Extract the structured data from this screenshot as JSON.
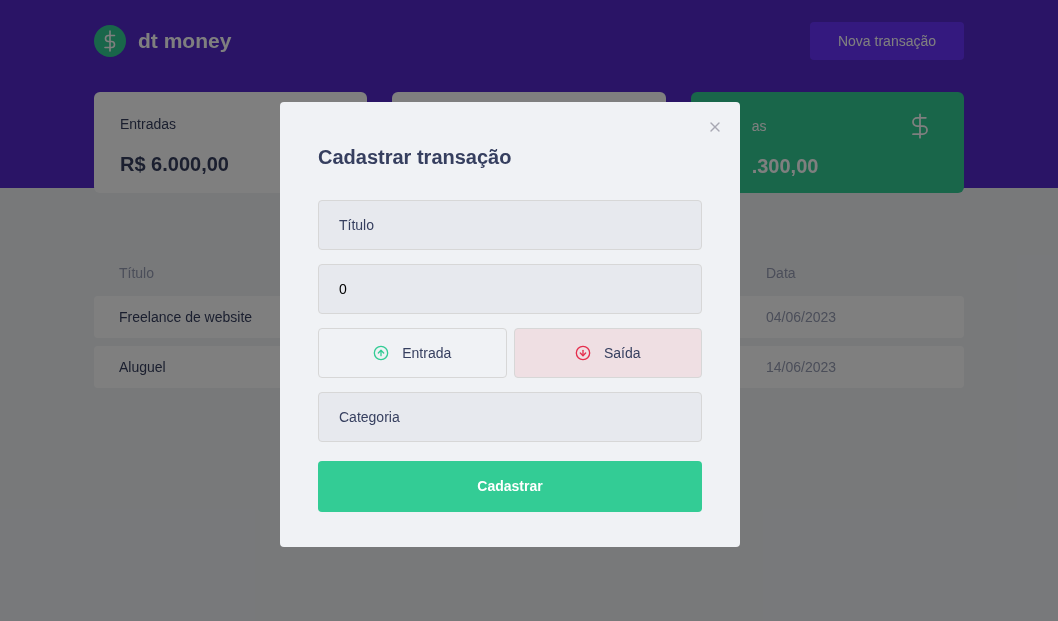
{
  "header": {
    "logo": "dt money",
    "new_button": "Nova transação"
  },
  "summary": [
    {
      "kind": "income",
      "label": "Entradas",
      "amount": "R$ 6.000,00"
    },
    {
      "kind": "hidden"
    },
    {
      "kind": "total",
      "label": "as",
      "amount": ".300,00"
    }
  ],
  "table": {
    "columns": [
      "Título",
      "Data"
    ],
    "rows": [
      {
        "cells": [
          "Freelance de website",
          "04/06/2023"
        ]
      },
      {
        "cells": [
          "Aluguel",
          "14/06/2023"
        ]
      }
    ]
  },
  "modal": {
    "title": "Cadastrar transação",
    "title_field": {
      "placeholder": "Título"
    },
    "amount_field": {
      "value": "0"
    },
    "type_options": [
      {
        "kind": "income",
        "label": "Entrada",
        "selected": false
      },
      {
        "kind": "outcome",
        "label": "Saída",
        "selected": true
      }
    ],
    "category_field": {
      "placeholder": "Categoria"
    },
    "submit": "Cadastrar"
  }
}
